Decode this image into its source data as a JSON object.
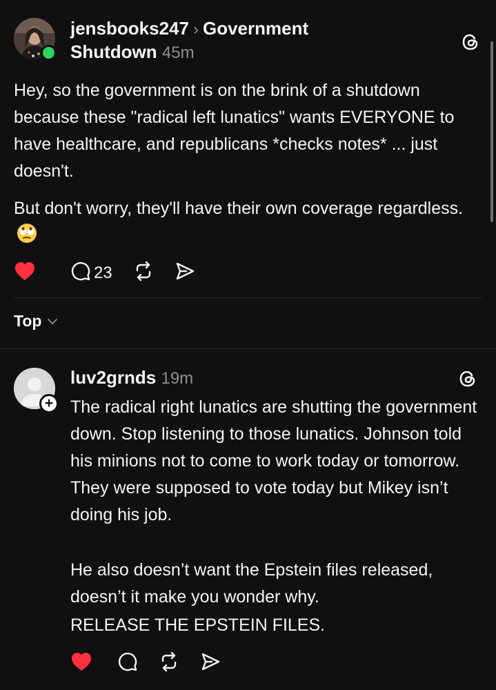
{
  "post": {
    "username": "jensbooks247",
    "topic": "Government Shutdown",
    "topic_line1": "Government",
    "topic_line2": "Shutdown",
    "time": "45m",
    "paragraph1": "Hey, so the government is on the brink of a shutdown because these \"radical left lunatics\" wants EVERYONE to have healthcare, and republicans *checks notes* ... just doesn't.",
    "paragraph2": "But don't worry, they'll have their own coverage regardless.",
    "reply_count": "23",
    "liked": true
  },
  "sort": {
    "label": "Top"
  },
  "reply": {
    "username": "luv2grnds",
    "time": "19m",
    "paragraph1": "The radical right lunatics are shutting the government down. Stop listening to those lunatics. Johnson told his minions not to come to work today or tomorrow. They were supposed to vote today but Mikey isn’t doing his job.",
    "paragraph2": "He also doesn’t want the Epstein files released, doesn’t it make you wonder why.",
    "paragraph3": "RELEASE THE EPSTEIN FILES.",
    "liked": true
  },
  "icons": {
    "like": "heart-icon",
    "reply": "speech-bubble-icon",
    "repost": "repost-icon",
    "share": "send-icon",
    "threads": "threads-logo-icon",
    "sort": "chevron-down-icon"
  },
  "colors": {
    "background": "#101010",
    "text": "#f3f5f7",
    "secondary": "#8e8e93",
    "like": "#ff3040",
    "online": "#2bd463"
  }
}
